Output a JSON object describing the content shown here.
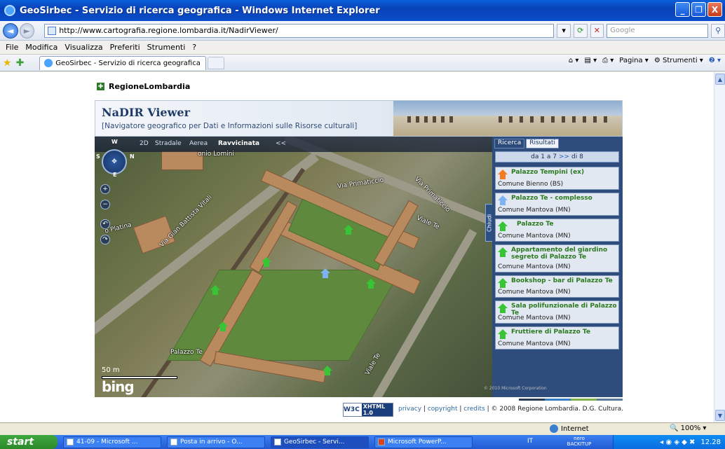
{
  "window": {
    "title": "GeoSirbec - Servizio di ricerca geografica - Windows Internet Explorer",
    "controls": [
      "_",
      "❐",
      "X"
    ]
  },
  "address": {
    "url": "http://www.cartografia.regione.lombardia.it/NadirViewer/",
    "search_placeholder": "Google"
  },
  "menu": [
    "File",
    "Modifica",
    "Visualizza",
    "Preferiti",
    "Strumenti",
    "?"
  ],
  "tab": {
    "label": "GeoSirbec - Servizio di ricerca geografica"
  },
  "commandbar": {
    "pagina": "Pagina",
    "strumenti": "Strumenti"
  },
  "page": {
    "logo": "RegioneLombardia",
    "banner_title": "NaDIR Viewer",
    "banner_subtitle": "[Navigatore geografico per Dati e Informazioni sulle Risorse culturali]"
  },
  "map": {
    "tabs": [
      "2D",
      "Stradale",
      "Aerea",
      "Ravvicinata",
      "<<"
    ],
    "compass": {
      "n": "W",
      "w": "S",
      "e": "N",
      "s": "E"
    },
    "labels": [
      "Via Primaticcio",
      "Via Primaticcio",
      "Viale Te",
      "Via Gian Battista Vitali",
      "o Platina",
      "Palazzo Te",
      "Viale Te",
      "onio Lomini"
    ],
    "scale": "50 m",
    "brand": "bing",
    "close_tab": "Chiudi"
  },
  "results": {
    "tabs": [
      "Ricerca",
      "Risultati"
    ],
    "pager": {
      "prefix": "da 1 a 7",
      "next": ">>",
      "suffix": "di 8"
    },
    "items": [
      {
        "title": "Palazzo Tempini (ex)",
        "comune": "Comune Bienno (BS)",
        "icon": "orange-house-icon"
      },
      {
        "title": "Palazzo Te - complesso",
        "comune": "Comune Mantova (MN)",
        "icon": "blue-house-icon"
      },
      {
        "title": "Palazzo Te",
        "comune": "Comune Mantova (MN)",
        "icon": "green-house-icon"
      },
      {
        "title": "Appartamento del giardino segreto di Palazzo Te",
        "comune": "Comune Mantova (MN)",
        "icon": "green-house-icon"
      },
      {
        "title": "Bookshop - bar di Palazzo Te",
        "comune": "Comune Mantova (MN)",
        "icon": "green-house-icon"
      },
      {
        "title": "Sala polifunzionale di Palazzo Te",
        "comune": "Comune Mantova (MN)",
        "icon": "green-house-icon"
      },
      {
        "title": "Fruttiere di Palazzo Te",
        "comune": "Comune Mantova (MN)",
        "icon": "green-house-icon"
      }
    ],
    "copyright": "© 2010 Microsoft Corporation"
  },
  "footer": {
    "w3c": "W3C",
    "xhtml": "XHTML 1.0",
    "privacy": "privacy",
    "copyright": "copyright",
    "credits": "credits",
    "sep": "|",
    "rights": "© 2008 Regione Lombardia. D.G. Cultura."
  },
  "status": {
    "zone": "Internet",
    "zoom": "100%"
  },
  "taskbar": {
    "start": "start",
    "buttons": [
      "41-09 - Microsoft ...",
      "Posta in arrivo - O...",
      "GeoSirbec - Servi...",
      "Microsoft PowerP..."
    ],
    "lang": "IT",
    "nero": "nero BACKITUP",
    "time": "12.28"
  },
  "colors": {
    "titlebar": "#0842b8",
    "panel": "#2f4d7c",
    "result_title": "#2a7a1f",
    "start": "#3fa83f"
  }
}
